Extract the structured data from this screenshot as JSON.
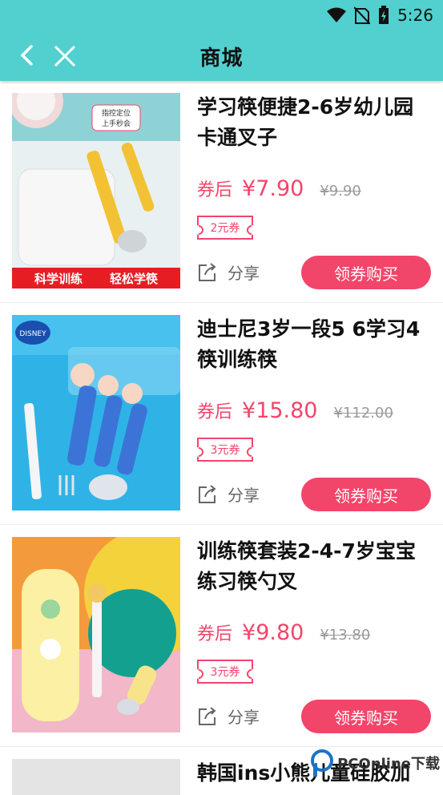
{
  "status_bar": {
    "time": "5:26"
  },
  "header": {
    "title": "商城"
  },
  "products": [
    {
      "name": "学习筷便捷2-6岁幼儿园卡通叉子",
      "after_label": "券后",
      "price": "¥7.90",
      "original_price": "¥9.90",
      "coupon": "2元券",
      "share_label": "分享",
      "buy_label": "领券购买",
      "image_texts": {
        "badge": "指控定位 上手秒会",
        "banner_left": "科学训练",
        "banner_right": "轻松学筷"
      }
    },
    {
      "name": "迪士尼3岁一段5 6学习4筷训练筷",
      "after_label": "券后",
      "price": "¥15.80",
      "original_price": "¥112.00",
      "coupon": "3元券",
      "share_label": "分享",
      "buy_label": "领券购买",
      "image_texts": {
        "brand": "DISNEY"
      }
    },
    {
      "name": "训练筷套装2-4-7岁宝宝练习筷勺叉",
      "after_label": "券后",
      "price": "¥9.80",
      "original_price": "¥13.80",
      "coupon": "3元券",
      "share_label": "分享",
      "buy_label": "领券购买",
      "image_texts": {}
    },
    {
      "name": "韩国ins小熊儿童硅胶加"
    }
  ],
  "watermark": "PCOnline下载",
  "colors": {
    "header": "#52d0cf",
    "accent": "#f2456a"
  }
}
